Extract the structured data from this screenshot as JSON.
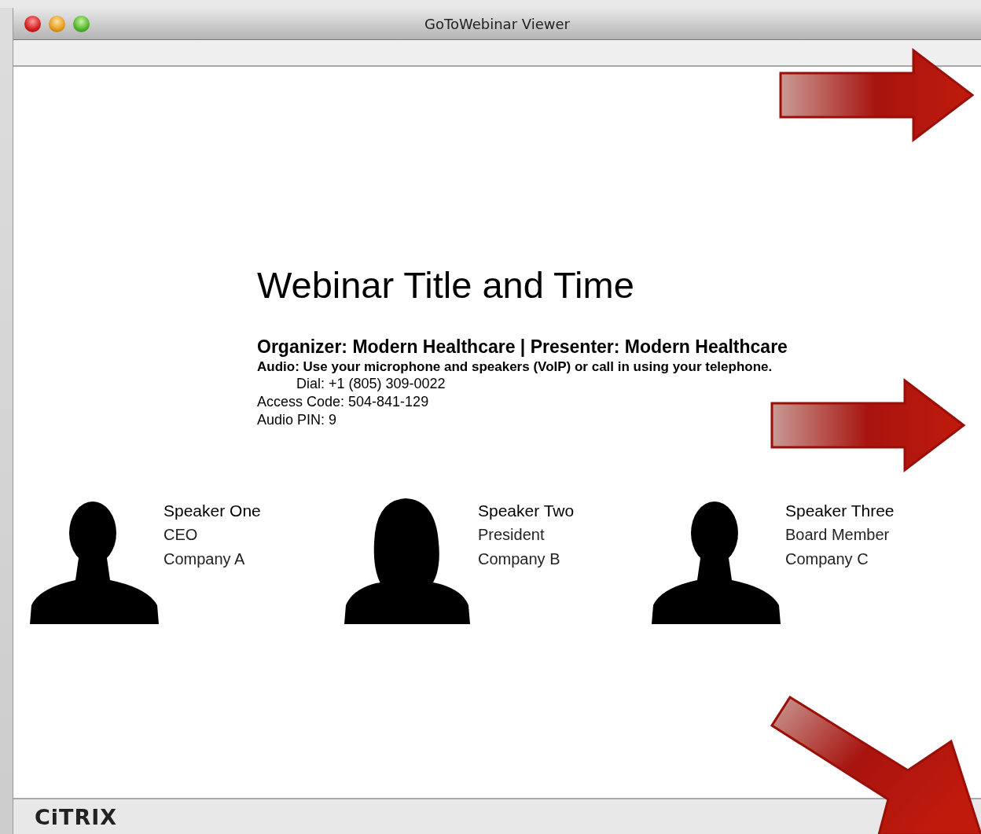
{
  "window": {
    "title": "GoToWebinar Viewer"
  },
  "slide": {
    "title": "Webinar Title and Time",
    "organizer": "Organizer: Modern Healthcare | Presenter: Modern Healthcare",
    "audio": "Audio: Use your microphone and speakers (VoIP) or call in using your telephone.",
    "dial": "Dial: +1 (805) 309-0022",
    "access_code": "Access Code: 504-841-129",
    "audio_pin": "Audio PIN: 9",
    "speakers": [
      {
        "name": "Speaker One",
        "role": "CEO",
        "company": "Company A",
        "kind": "male"
      },
      {
        "name": "Speaker Two",
        "role": "President",
        "company": "Company B",
        "kind": "female"
      },
      {
        "name": "Speaker Three",
        "role": "Board Member",
        "company": "Company C",
        "kind": "male"
      }
    ]
  },
  "footer": {
    "logo": "CiTRIX"
  }
}
